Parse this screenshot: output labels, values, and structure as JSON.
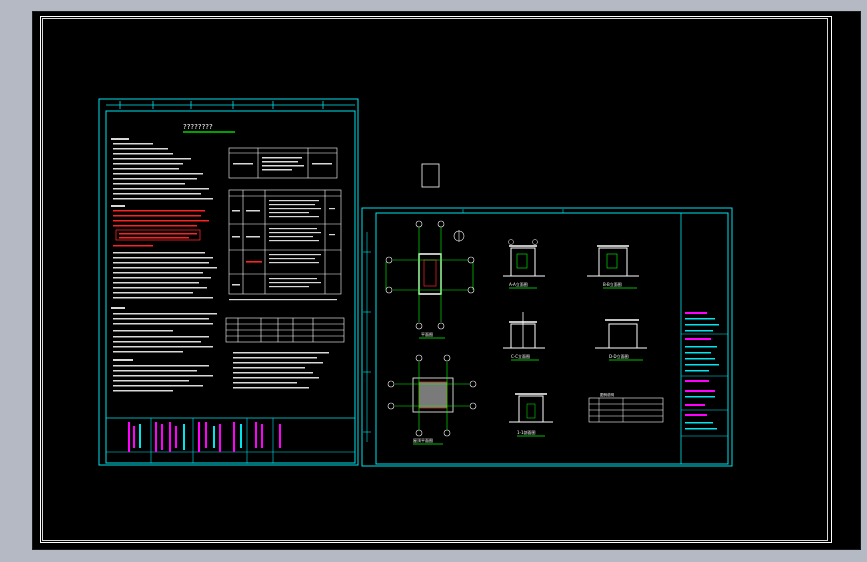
{
  "window": {
    "title": ""
  },
  "colors": {
    "background": "#b4b9c3",
    "canvas": "#000000",
    "sheet_border": "#00e5ee",
    "linework": "#ffffff",
    "annotation": "#00ff00",
    "highlight": "#ff2020",
    "title_block_text": "#ff00ff"
  },
  "sheet1": {
    "title": "????????",
    "table_heading": "图纸目录",
    "schedule_heading": "门窗表"
  },
  "sheet2": {
    "view_labels": [
      "平面图",
      "A-A立面图",
      "B-B立面图",
      "C-C立面图",
      "D-D立面图",
      "屋顶平面图",
      "1-1剖面图"
    ],
    "legend_heading": "图例说明"
  }
}
